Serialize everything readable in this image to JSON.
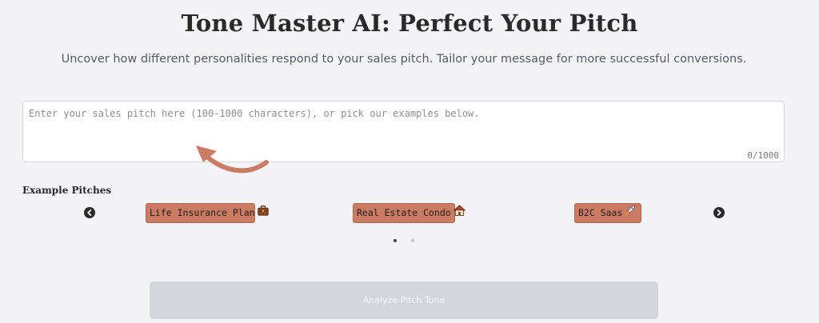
{
  "header": {
    "title": "Tone Master AI: Perfect Your Pitch",
    "subtitle": "Uncover how different personalities respond to your sales pitch. Tailor your message for more successful conversions."
  },
  "pitch_input": {
    "value": "",
    "placeholder": "Enter your sales pitch here (100-1000 characters), or pick our examples below.",
    "char_count": "0/1000"
  },
  "examples": {
    "heading": "Example Pitches",
    "items": [
      {
        "label": "Life Insurance Plan",
        "icon": "briefcase-icon",
        "emoji": "💼"
      },
      {
        "label": "Real Estate Condo",
        "icon": "house-icon",
        "emoji": "🏠"
      },
      {
        "label": "B2C Saas",
        "icon": "rocket-icon",
        "emoji": "🚀"
      }
    ],
    "pagination": {
      "current_page": 1,
      "total_pages": 2
    }
  },
  "actions": {
    "analyze_label": "Analyze Pitch Tone",
    "analyze_enabled": false
  },
  "colors": {
    "background": "#f4f4f6",
    "chip": "#c97b63",
    "arrow": "#c97b63",
    "button_disabled": "#d4d6dc"
  }
}
